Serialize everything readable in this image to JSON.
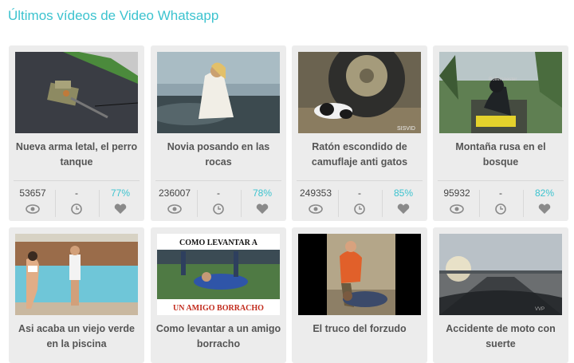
{
  "page": {
    "title": "Últimos vídeos de Video Whatsapp"
  },
  "colors": {
    "accent": "#3cc3cf",
    "card_bg": "#ececec",
    "icon": "#8a8a8a"
  },
  "videos": [
    {
      "caption": "Nueva arma letal, el perro tanque",
      "views": "53657",
      "mid": "-",
      "rating": "77%"
    },
    {
      "caption": "Novia posando en las rocas",
      "views": "236007",
      "mid": "-",
      "rating": "78%"
    },
    {
      "caption": "Ratón escondido de camuflaje anti gatos",
      "views": "249353",
      "mid": "-",
      "rating": "85%"
    },
    {
      "caption": "Montaña rusa en el bosque",
      "views": "95932",
      "mid": "-",
      "rating": "82%"
    },
    {
      "caption": "Asi acaba un viejo verde en la piscina"
    },
    {
      "caption": "Como levantar a un amigo borracho",
      "thumb_text_top": "COMO LEVANTAR A",
      "thumb_text_bottom": "UN AMIGO BORRACHO"
    },
    {
      "caption": "El truco del forzudo"
    },
    {
      "caption": "Accidente de moto con suerte"
    }
  ],
  "icons": {
    "views": "eye-icon",
    "time": "clock-icon",
    "likes": "heart-icon"
  }
}
